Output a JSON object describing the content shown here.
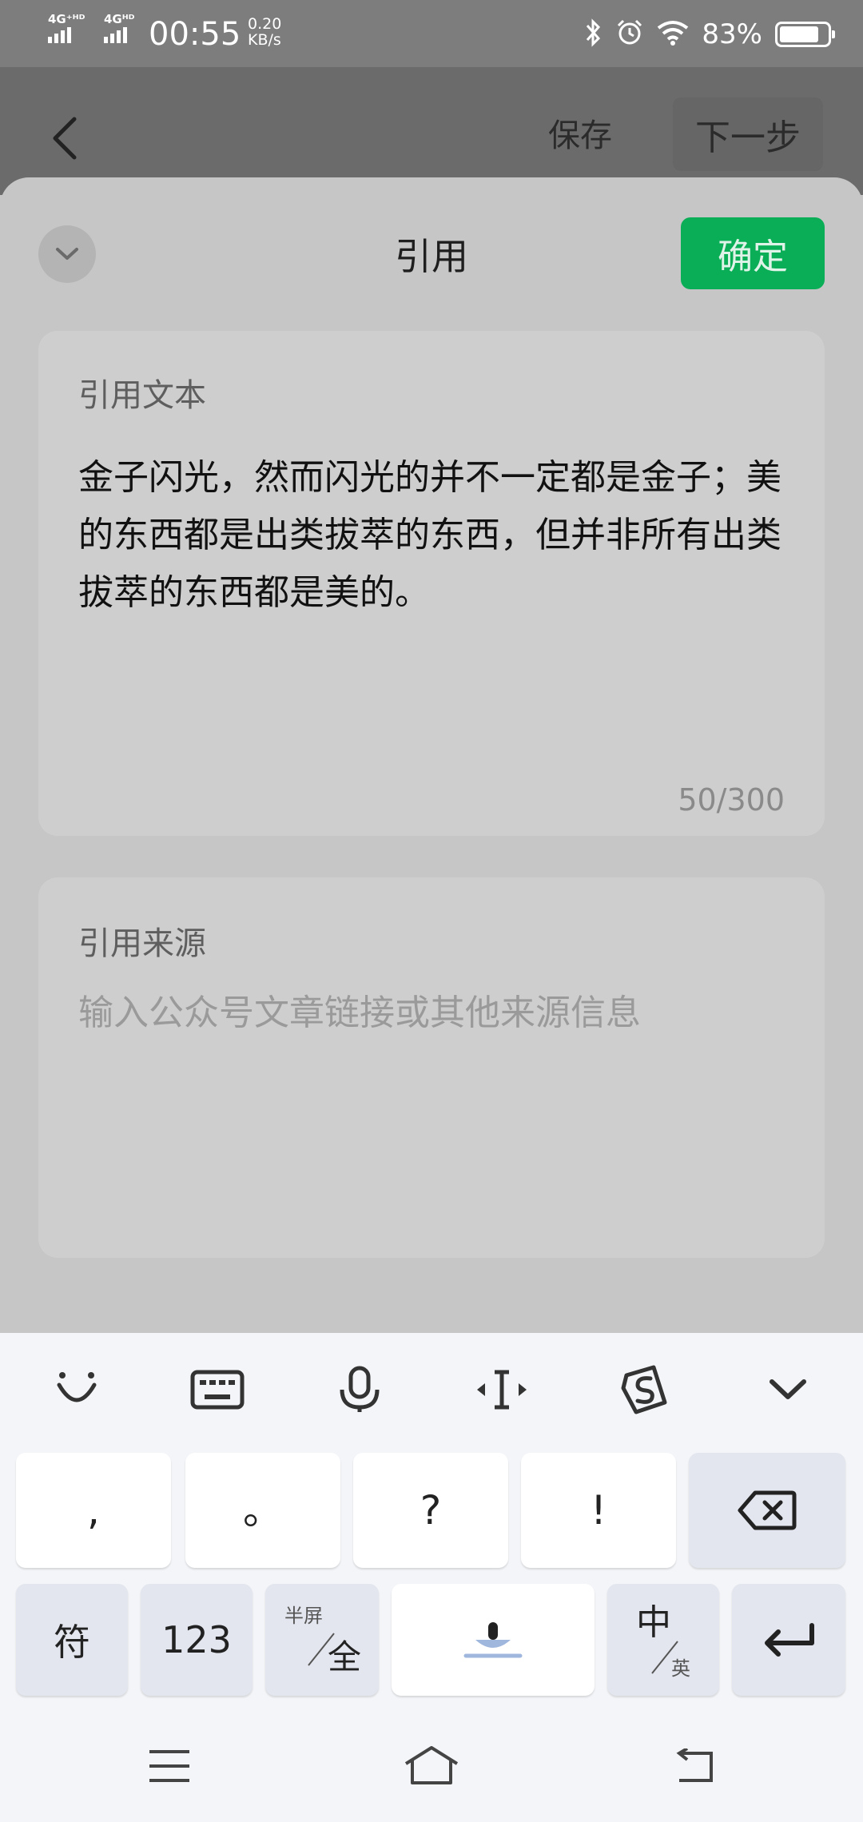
{
  "status_bar": {
    "network_1": "4G⁺ᴴᴰ",
    "network_2": "4Gᴴᴰ",
    "time": "00:55",
    "speed_value": "0.20",
    "speed_unit": "KB/s",
    "battery_percent": "83%",
    "battery_level": 0.83,
    "icons": [
      "bluetooth-icon",
      "alarm-icon",
      "wifi-icon",
      "battery-icon"
    ]
  },
  "header": {
    "back_icon": "chevron-left-icon",
    "save_label": "保存",
    "next_label": "下一步"
  },
  "sheet": {
    "title": "引用",
    "collapse_icon": "chevron-down-icon",
    "confirm_label": "确定",
    "confirm_color": "#0aae56",
    "quote": {
      "label": "引用文本",
      "value": "金子闪光，然而闪光的并不一定都是金子；美的东西都是出类拔萃的东西，但并非所有出类拔萃的东西都是美的。",
      "counter": "50/300"
    },
    "source": {
      "label": "引用来源",
      "placeholder": "输入公众号文章链接或其他来源信息"
    }
  },
  "keyboard": {
    "toolbar_icons": [
      "emoji-icon",
      "keyboard-icon",
      "microphone-icon",
      "cursor-move-icon",
      "sogou-logo-icon",
      "hide-keyboard-icon"
    ],
    "row1": [
      ",",
      "。",
      "?",
      "!"
    ],
    "row1_delete_icon": "backspace-icon",
    "row2": {
      "symbols": "符",
      "numbers": "123",
      "width_top": "半屏",
      "width_bottom": "全",
      "space_icon": "voice-space-icon",
      "lang_top": "中",
      "lang_bottom": "英",
      "enter_icon": "enter-icon"
    }
  },
  "nav_bar": {
    "icons": [
      "menu-icon",
      "home-icon",
      "back-icon"
    ]
  }
}
